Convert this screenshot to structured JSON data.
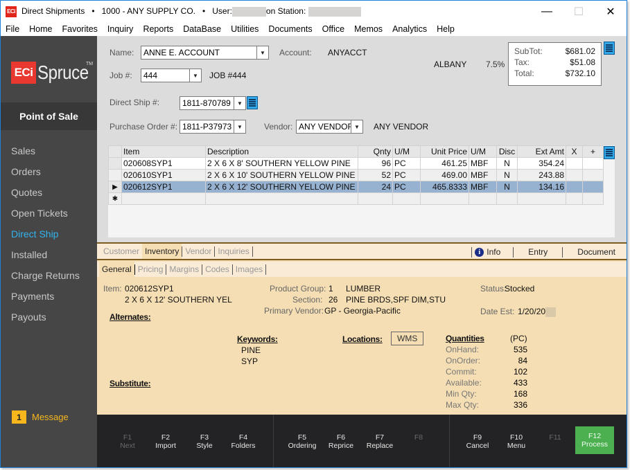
{
  "window": {
    "title": "Direct Shipments",
    "separator": "•",
    "company": "1000 - ANY SUPPLY CO.",
    "user_label": "User:",
    "station_label": "on Station:",
    "app_badge": "ECi",
    "controls": {
      "minimize": "—",
      "maximize": "☐",
      "close": "✕"
    }
  },
  "menu": [
    "File",
    "Home",
    "Favorites",
    "Inquiry",
    "Reports",
    "DataBase",
    "Utilities",
    "Documents",
    "Office",
    "Memos",
    "Analytics",
    "Help"
  ],
  "sidebar": {
    "logo_badge": "ECi",
    "logo_word": "Spruce",
    "logo_tm": "TM",
    "section": "Point of Sale",
    "items": [
      {
        "label": "Sales",
        "active": false
      },
      {
        "label": "Orders",
        "active": false
      },
      {
        "label": "Quotes",
        "active": false
      },
      {
        "label": "Open Tickets",
        "active": false
      },
      {
        "label": "Direct Ship",
        "active": true
      },
      {
        "label": "Installed",
        "active": false
      },
      {
        "label": "Charge Returns",
        "active": false
      },
      {
        "label": "Payments",
        "active": false
      },
      {
        "label": "Payouts",
        "active": false
      }
    ],
    "message_count": "1",
    "message_label": "Message"
  },
  "header": {
    "name_label": "Name:",
    "name_value": "ANNE E. ACCOUNT",
    "account_label": "Account:",
    "account_value": "ANYACCT",
    "job_label": "Job #:",
    "job_value": "444",
    "job_desc": "JOB #444",
    "tax_location": "ALBANY",
    "tax_rate": "7.5%",
    "direct_ship_label": "Direct Ship #:",
    "direct_ship_value": "1811-870789",
    "po_label": "Purchase Order #:",
    "po_value": "1811-P37973",
    "vendor_label": "Vendor:",
    "vendor_value": "ANY VENDOR",
    "vendor_name": "ANY VENDOR",
    "totals": {
      "subtotal_label": "SubTot:",
      "subtotal": "$681.02",
      "tax_label": "Tax:",
      "tax": "$51.08",
      "total_label": "Total:",
      "total": "$732.10"
    }
  },
  "grid": {
    "columns": [
      "Item",
      "Description",
      "Qnty",
      "U/M",
      "Unit Price",
      "U/M",
      "Disc",
      "Ext Amt",
      "X",
      "+"
    ],
    "rows": [
      {
        "item": "020608SYP1",
        "description": "2 X 6 X 8' SOUTHERN YELLOW PINE",
        "qty": "96",
        "um": "PC",
        "unit_price": "461.25",
        "price_um": "MBF",
        "disc": "N",
        "ext_amt": "354.24",
        "selected": false
      },
      {
        "item": "020610SYP1",
        "description": "2 X 6 X 10' SOUTHERN YELLOW PINE",
        "qty": "52",
        "um": "PC",
        "unit_price": "469.00",
        "price_um": "MBF",
        "disc": "N",
        "ext_amt": "243.88",
        "selected": false
      },
      {
        "item": "020612SYP1",
        "description": "2 X 6 X 12' SOUTHERN YELLOW PINE",
        "qty": "24",
        "um": "PC",
        "unit_price": "465.8333",
        "price_um": "MBF",
        "disc": "N",
        "ext_amt": "134.16",
        "selected": true
      }
    ],
    "current_row_marker": "▶",
    "new_row_marker": "✱"
  },
  "detail": {
    "tabs": [
      {
        "label": "Customer",
        "active": false
      },
      {
        "label": "Inventory",
        "active": true
      },
      {
        "label": "Vendor",
        "active": false
      },
      {
        "label": "Inquiries",
        "active": false
      }
    ],
    "right_links": [
      "Info",
      "Entry",
      "Document"
    ],
    "subtabs": [
      {
        "label": "General",
        "active": true
      },
      {
        "label": "Pricing",
        "active": false
      },
      {
        "label": "Margins",
        "active": false
      },
      {
        "label": "Codes",
        "active": false
      },
      {
        "label": "Images",
        "active": false
      }
    ],
    "item_label": "Item:",
    "item_code": "020612SYP1",
    "item_desc": "2 X 6 X 12' SOUTHERN YEL",
    "product_group_label": "Product Group:",
    "product_group_code": "1",
    "product_group_name": "LUMBER",
    "section_label": "Section:",
    "section_code": "26",
    "section_name": "PINE BRDS,SPF DIM,STU",
    "primary_vendor_label": "Primary Vendor:",
    "primary_vendor": "GP - Georgia-Pacific",
    "status_label": "Status:",
    "status_value": "Stocked",
    "date_est_label": "Date Est:",
    "date_est_value": "1/20/20",
    "alternates_label": "Alternates:",
    "substitute_label": "Substitute:",
    "keywords_label": "Keywords:",
    "keywords": [
      "PINE",
      "SYP"
    ],
    "locations_label": "Locations:",
    "locations_button": "WMS",
    "quantities_label": "Quantities",
    "quantities_unit": "(PC)",
    "quantities": [
      {
        "label": "OnHand:",
        "value": "535"
      },
      {
        "label": "OnOrder:",
        "value": "84"
      },
      {
        "label": "Commit:",
        "value": "102"
      },
      {
        "label": "Available:",
        "value": "433"
      },
      {
        "label": "Min Qty:",
        "value": "168"
      },
      {
        "label": "Max Qty:",
        "value": "336"
      }
    ]
  },
  "fkeys": [
    {
      "key": "F1",
      "label": "Next",
      "enabled": false
    },
    {
      "key": "F2",
      "label": "Import",
      "enabled": true
    },
    {
      "key": "F3",
      "label": "Style",
      "enabled": true
    },
    {
      "key": "F4",
      "label": "Folders",
      "enabled": true
    },
    {
      "key": "F5",
      "label": "Ordering",
      "enabled": true
    },
    {
      "key": "F6",
      "label": "Reprice",
      "enabled": true
    },
    {
      "key": "F7",
      "label": "Replace",
      "enabled": true
    },
    {
      "key": "F8",
      "label": "",
      "enabled": false
    },
    {
      "key": "F9",
      "label": "Cancel",
      "enabled": true
    },
    {
      "key": "F10",
      "label": "Menu",
      "enabled": true
    },
    {
      "key": "F11",
      "label": "",
      "enabled": false
    },
    {
      "key": "F12",
      "label": "Process",
      "enabled": true,
      "primary": true
    }
  ],
  "colors": {
    "accent_blue": "#32b4f0",
    "message_yellow": "#f7b71d",
    "process_green": "#4caf50",
    "selected_row": "#97b2d1",
    "detail_bg": "#f5deb3",
    "brand_red": "#e8382f"
  }
}
